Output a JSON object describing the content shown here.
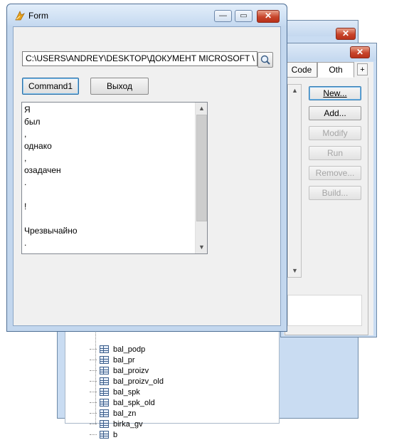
{
  "form": {
    "title": "Form",
    "path_value": "C:\\USERS\\ANDREY\\DESKTOP\\ДОКУМЕНТ MICROSOFT \\",
    "command1_label": "Command1",
    "exit_label": "Выход",
    "list_items": [
      "Я",
      "был",
      ",",
      "однако",
      ",",
      "озадачен",
      ".",
      "",
      "!",
      "",
      "Чрезвычайно",
      "."
    ],
    "title_buttons": {
      "minimize": "—",
      "maximize": "▭",
      "close": "✕"
    }
  },
  "project_manager": {
    "tabs": [
      "Code",
      "Oth",
      "+"
    ],
    "buttons": {
      "new": "New...",
      "add": "Add...",
      "modify": "Modify",
      "run": "Run",
      "remove": "Remove...",
      "build": "Build..."
    },
    "close": "✕"
  },
  "back_window": {
    "close": "✕",
    "tree_items": [
      "bal_podp",
      "bal_pr",
      "bal_proizv",
      "bal_proizv_old",
      "bal_spk",
      "bal_spk_old",
      "bal_zn",
      "birka_gv",
      "b"
    ]
  },
  "colors": {
    "title_bar": "#c5d9f0",
    "close_button": "#c8452b",
    "window_face": "#f0f0f0"
  }
}
